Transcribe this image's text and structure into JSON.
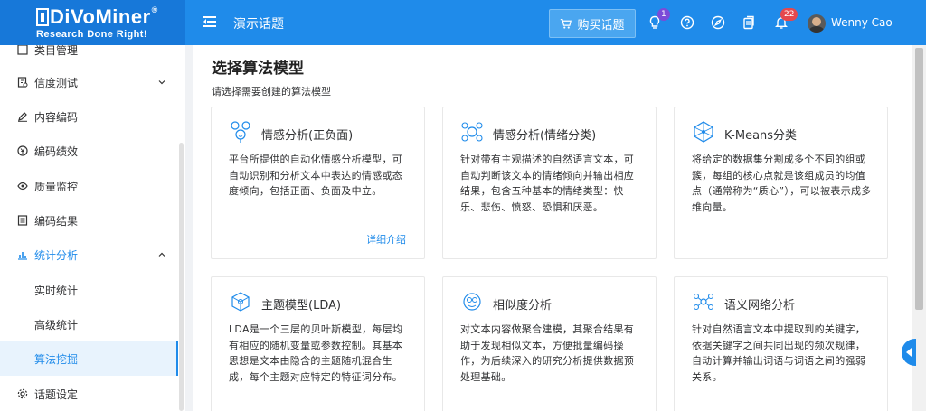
{
  "header": {
    "logo_main": "DiVoMiner",
    "logo_sub": "Research Done Right!",
    "project_title": "演示话题",
    "buy_label": "购买话题",
    "notification_count": "1",
    "message_count": "22",
    "username": "Wenny Cao",
    "icons": [
      "cart-icon",
      "bulb-icon",
      "help-icon",
      "compass-icon",
      "clipboard-icon",
      "bell-icon"
    ]
  },
  "sidebar": {
    "items": [
      {
        "label": "类目管理"
      },
      {
        "label": "信度测试"
      },
      {
        "label": "内容编码"
      },
      {
        "label": "编码绩效"
      },
      {
        "label": "质量监控"
      },
      {
        "label": "编码结果"
      },
      {
        "label": "统计分析"
      },
      {
        "label": "实时统计"
      },
      {
        "label": "高级统计"
      },
      {
        "label": "算法挖掘"
      },
      {
        "label": "话题设定"
      }
    ]
  },
  "main": {
    "title": "选择算法模型",
    "subtitle": "请选择需要创建的算法模型",
    "cards": [
      {
        "title": "情感分析(正负面)",
        "desc": "平台所提供的自动化情感分析模型，可自动识别和分析文本中表达的情感或态度倾向，包括正面、负面及中立。",
        "link": "详细介绍"
      },
      {
        "title": "情感分析(情绪分类)",
        "desc": "针对带有主观描述的自然语言文本，可自动判断该文本的情绪倾向并输出相应结果，包含五种基本的情绪类型：快乐、悲伤、愤怒、恐惧和厌恶。"
      },
      {
        "title": "K-Means分类",
        "desc": "将给定的数据集分割成多个不同的组或簇，每组的核心点就是该组成员的均值点（通常称为“质心”），可以被表示成多维向量。"
      },
      {
        "title": "主题模型(LDA)",
        "desc": "LDA是一个三层的贝叶斯模型，每层均有相应的随机变量或参数控制。其基本思想是文本由隐含的主题随机混合生成，每个主题对应特定的特征词分布。"
      },
      {
        "title": "相似度分析",
        "desc": "对文本内容做聚合建模，其聚合结果有助于发现相似文本，方便批量编码操作，为后续深入的研究分析提供数据预处理基础。"
      },
      {
        "title": "语义网络分析",
        "desc": "针对自然语言文本中提取到的关键字，依据关键字之间共同出现的频次规律，自动计算并输出词语与词语之间的强弱关系。"
      }
    ]
  },
  "colors": {
    "primary": "#1f8bea",
    "badge_red": "#e5484d",
    "badge_purple": "#7b4bd8"
  }
}
